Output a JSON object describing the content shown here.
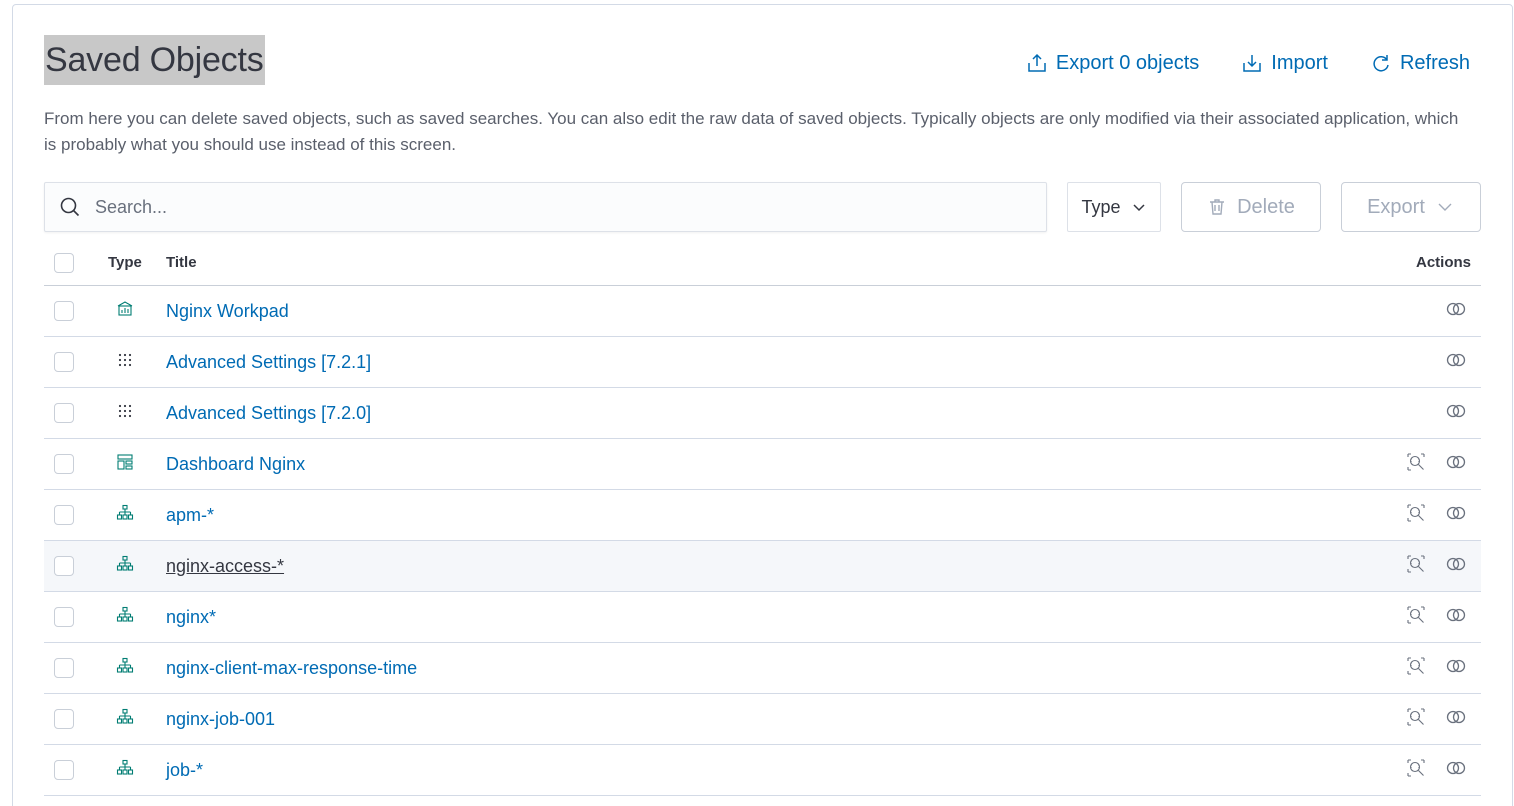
{
  "header": {
    "title": "Saved Objects",
    "export_label": "Export 0 objects",
    "import_label": "Import",
    "refresh_label": "Refresh"
  },
  "description": "From here you can delete saved objects, such as saved searches. You can also edit the raw data of saved objects. Typically objects are only modified via their associated application, which is probably what you should use instead of this screen.",
  "toolbar": {
    "search_placeholder": "Search...",
    "type_filter_label": "Type",
    "delete_label": "Delete",
    "export_label": "Export"
  },
  "table": {
    "headers": {
      "type": "Type",
      "title": "Title",
      "actions": "Actions"
    },
    "rows": [
      {
        "type_icon": "canvas-workpad-icon",
        "title": "Nginx Workpad",
        "inspect": false
      },
      {
        "type_icon": "advanced-settings-icon",
        "title": "Advanced Settings [7.2.1]",
        "inspect": false
      },
      {
        "type_icon": "advanced-settings-icon",
        "title": "Advanced Settings [7.2.0]",
        "inspect": false
      },
      {
        "type_icon": "dashboard-icon",
        "title": "Dashboard Nginx",
        "inspect": true
      },
      {
        "type_icon": "index-pattern-icon",
        "title": "apm-*",
        "inspect": true
      },
      {
        "type_icon": "index-pattern-icon",
        "title": "nginx-access-*",
        "inspect": true
      },
      {
        "type_icon": "index-pattern-icon",
        "title": "nginx*",
        "inspect": true
      },
      {
        "type_icon": "index-pattern-icon",
        "title": "nginx-client-max-response-time",
        "inspect": true
      },
      {
        "type_icon": "index-pattern-icon",
        "title": "nginx-job-001",
        "inspect": true
      },
      {
        "type_icon": "index-pattern-icon",
        "title": "job-*",
        "inspect": true
      }
    ]
  },
  "colors": {
    "link": "#006bb4",
    "icon_teal": "#017d73",
    "text": "#343741",
    "disabled": "#a2abba"
  }
}
